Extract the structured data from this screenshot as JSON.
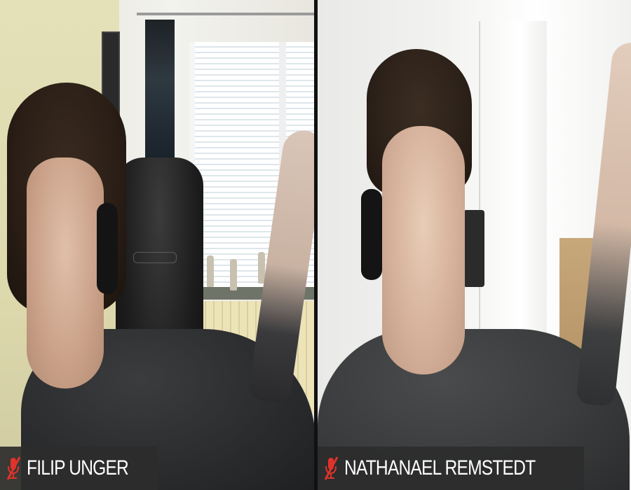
{
  "call": {
    "participants": [
      {
        "name": "FILIP UNGER",
        "mic_icon": "mic-muted-icon",
        "mic_status_color": "#e0332b"
      },
      {
        "name": "NATHANAEL REMSTEDT",
        "mic_icon": "mic-muted-icon",
        "mic_status_color": "#e0332b"
      }
    ]
  },
  "colors": {
    "name_tag_bg": "#2d2d2d",
    "name_text": "#ffffff",
    "muted_red": "#e0332b"
  }
}
